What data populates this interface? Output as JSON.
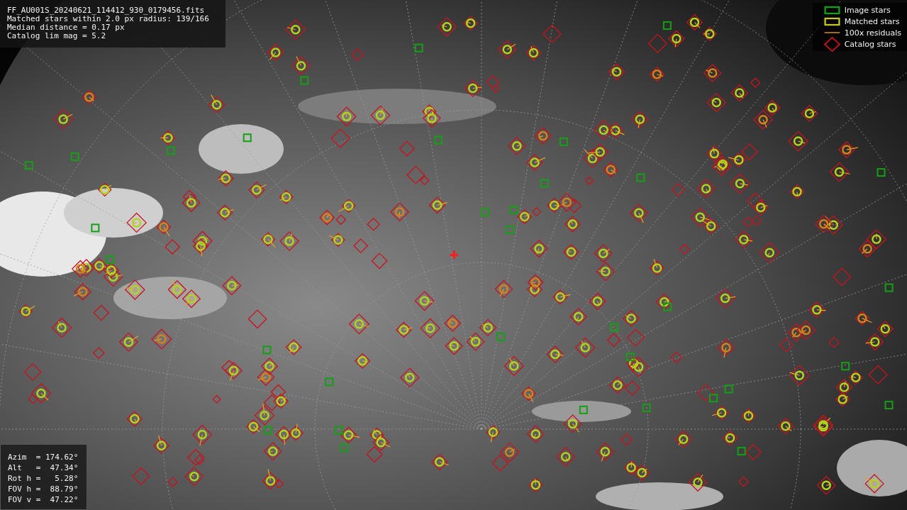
{
  "file_info": {
    "lines": [
      "FF_AU001S_20240621_114412_930_0179456.fits",
      "Matched stars within 2.0 px radius: 139/166",
      "Median distance = 0.17 px",
      "Catalog lim mag = 5.2"
    ]
  },
  "legend": [
    {
      "label": "Image stars"
    },
    {
      "label": "Matched stars",
      "kind": "matched"
    },
    {
      "label": "100x residuals",
      "kind": "residual"
    },
    {
      "label": "Catalog stars",
      "kind": "catalog"
    }
  ],
  "pointing": {
    "lines": [
      "Azim  = 174.62°",
      "Alt   =  47.34°",
      "Rot h =   5.28°",
      "FOV h =  88.79°",
      "FOV v =  47.22°"
    ]
  }
}
